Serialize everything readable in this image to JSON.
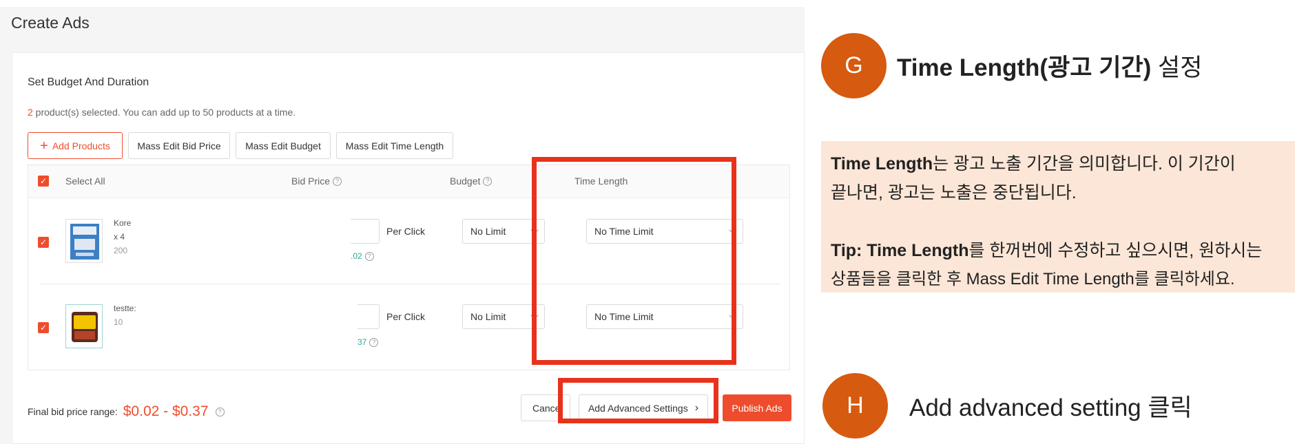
{
  "panel": {
    "title": "Create Ads",
    "section_title": "Set Budget And Duration",
    "selected_count": "2",
    "selected_text": " product(s) selected. You can add up to 50 products at a time.",
    "buttons": {
      "add_products": "Add Products",
      "mass_edit_bid": "Mass Edit Bid Price",
      "mass_edit_budget": "Mass Edit Budget",
      "mass_edit_time": "Mass Edit Time Length"
    },
    "table": {
      "headers": {
        "select_all": "Select All",
        "bid_price": "Bid Price",
        "budget": "Budget",
        "time_length": "Time Length"
      },
      "rows": [
        {
          "name": "Kore",
          "qty": "x 4",
          "extra": "200",
          "per_click": "Per Click",
          "suggested": ".02",
          "budget": "No Limit",
          "time_length": "No Time Limit"
        },
        {
          "name": "testte:",
          "qty": "10",
          "extra": "",
          "per_click": "Per Click",
          "suggested": "37",
          "budget": "No Limit",
          "time_length": "No Time Limit"
        }
      ]
    },
    "final_label": "Final bid price range:",
    "final_price": "$0.02 - $0.37",
    "footer_buttons": {
      "cancel": "Cance",
      "advanced": "Add Advanced Settings",
      "publish": "Publish Ads"
    }
  },
  "annotations": {
    "g": {
      "letter": "G",
      "title_bold": "Time Length(광고 기간)",
      "title_rest": " 설정"
    },
    "tip": {
      "line1_bold": "Time Length",
      "line1_rest": "는 광고 노출 기간을 의미합니다. 이 기간이",
      "line2": "끝나면, 광고는 노출은 중단됩니다.",
      "line3_bold": "Tip: Time Length",
      "line3_rest": "를 한꺼번에 수정하고 싶으시면, 원하시는",
      "line4": "상품들을 클릭한 후 Mass Edit Time Length를 클릭하세요."
    },
    "h": {
      "letter": "H",
      "title": "Add advanced setting 클릭"
    }
  },
  "colors": {
    "accent": "#ee4d2d",
    "highlight": "#e8321b",
    "circle": "#d65a0f",
    "tip_bg": "#fbe6d7"
  }
}
